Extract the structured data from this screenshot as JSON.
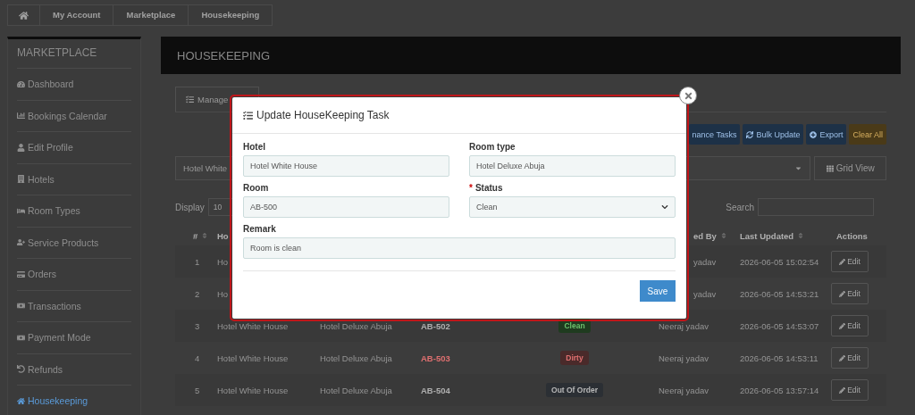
{
  "breadcrumb": [
    "My Account",
    "Marketplace",
    "Housekeeping"
  ],
  "sidebar": {
    "title": "MARKETPLACE",
    "items": [
      {
        "label": "Dashboard",
        "selected": false
      },
      {
        "label": "Bookings Calendar",
        "selected": false
      },
      {
        "label": "Edit Profile",
        "selected": false
      },
      {
        "label": "Hotels",
        "selected": false
      },
      {
        "label": "Room Types",
        "selected": false
      },
      {
        "label": "Service Products",
        "selected": false
      },
      {
        "label": "Orders",
        "selected": false
      },
      {
        "label": "Transactions",
        "selected": false
      },
      {
        "label": "Payment Mode",
        "selected": false
      },
      {
        "label": "Refunds",
        "selected": false
      },
      {
        "label": "Housekeeping",
        "selected": true
      }
    ]
  },
  "page_title": "HOUSEKEEPING",
  "tabs": [
    {
      "label": "Manage",
      "selected": true
    }
  ],
  "toolbar_buttons": [
    {
      "label": "nance Tasks",
      "kind": "primary"
    },
    {
      "label": "Bulk Update",
      "kind": "primary"
    },
    {
      "label": "Export",
      "kind": "primary"
    },
    {
      "label": "Clear All",
      "kind": "warning"
    }
  ],
  "filters": {
    "hotel": "Hotel White",
    "grid_view": "Grid View"
  },
  "display": {
    "label": "Display",
    "value": "10"
  },
  "search": {
    "label": "Search"
  },
  "table": {
    "columns": [
      {
        "label": "#",
        "sortable": true
      },
      {
        "label": "Ho",
        "sortable": false
      },
      {
        "label": "ed By",
        "sortable": true
      },
      {
        "label": "Last Updated",
        "sortable": true
      },
      {
        "label": "Actions",
        "sortable": false
      }
    ],
    "rows": [
      {
        "number": "1",
        "hotel": "Ho",
        "assigned_by": "yadav",
        "last_updated": "2026-06-05 15:02:54",
        "action": "Edit"
      },
      {
        "number": "2",
        "hotel": "Ho",
        "assigned_by": "yadav",
        "last_updated": "2026-06-05 14:53:21",
        "action": "Edit"
      },
      {
        "number": "3",
        "hotel": "Hotel White House",
        "room_type": "Hotel Deluxe Abuja",
        "room": "AB-502",
        "status": {
          "label": "Clean",
          "kind": "clean"
        },
        "assigned_by": "Neeraj yadav",
        "last_updated": "2026-06-05 14:53:07",
        "action": "Edit"
      },
      {
        "number": "4",
        "hotel": "Hotel White House",
        "room_type": "Hotel Deluxe Abuja",
        "room": "AB-503",
        "status": {
          "label": "Dirty",
          "kind": "dirty"
        },
        "assigned_by": "Neeraj yadav",
        "last_updated": "2026-06-05 14:53:11",
        "action": "Edit"
      },
      {
        "number": "5",
        "hotel": "Hotel White House",
        "room_type": "Hotel Deluxe Abuja",
        "room": "AB-504",
        "status": {
          "label": "Out Of Order",
          "kind": "out_of_order"
        },
        "assigned_by": "Neeraj yadav",
        "last_updated": "2026-06-05 13:57:14",
        "action": "Edit"
      }
    ]
  },
  "modal": {
    "title": "Update HouseKeeping Task",
    "fields": [
      {
        "label": "Hotel",
        "value": "Hotel White House",
        "kind": "text",
        "wide": false
      },
      {
        "label": "Room type",
        "value": "Hotel Deluxe Abuja",
        "kind": "text",
        "wide": false
      },
      {
        "label": "Room",
        "value": "AB-500",
        "kind": "text",
        "wide": false
      },
      {
        "label": "Status",
        "value": "Clean",
        "kind": "select",
        "required_mark": "*",
        "wide": false
      },
      {
        "label": "Remark",
        "value": "Room is clean",
        "kind": "text",
        "wide": true
      }
    ],
    "save": "Save"
  }
}
